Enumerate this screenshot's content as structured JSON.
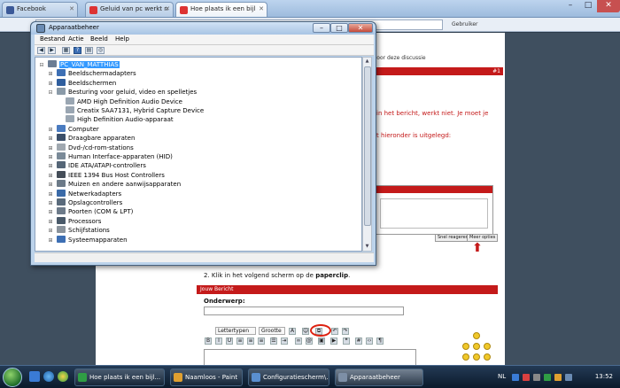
{
  "browser": {
    "tabs": [
      {
        "label": "Facebook"
      },
      {
        "label": "Geluid van pc werkt n"
      },
      {
        "label": "Hoe plaats ik een bijl"
      }
    ],
    "controls": {
      "minimize": "–",
      "maximize": "□",
      "close": "✕"
    },
    "user_label": "Gebruiker"
  },
  "forum": {
    "nav": [
      "doorzoeken",
      "Geef een waardering voor deze discussie"
    ],
    "post_number": "#1",
    "red_lines": [
      "in het bericht, werkt niet. Je moet je",
      "t hieronder is uitgelegd:"
    ],
    "buttons": {
      "preview": "Snel reageren",
      "advanced": "Meer opties"
    },
    "step2_prefix": "2. Klik in het volgend scherm op de",
    "step2_bold": "paperclip",
    "step2_suffix": ".",
    "reply_header": "Jouw Bericht",
    "subject_label": "Onderwerp:",
    "font_select": "Lettertypen",
    "size_select": "Grootte"
  },
  "device_manager": {
    "title": "Apparaatbeheer",
    "menu": [
      "Bestand",
      "Actie",
      "Beeld",
      "Help"
    ],
    "tree": [
      {
        "label": "PC_VAN_MATTHIAS",
        "expander": "⊟",
        "level": 0,
        "icon": "#6b7d94",
        "icon_name": "computer-icon"
      },
      {
        "label": "Beeldschermadapters",
        "expander": "⊞",
        "level": 1,
        "icon": "#3d6fb4",
        "icon_name": "display-adapter-icon"
      },
      {
        "label": "Beeldschermen",
        "expander": "⊞",
        "level": 1,
        "icon": "#2f5e9e",
        "icon_name": "monitor-icon"
      },
      {
        "label": "Besturing voor geluid, video en spelletjes",
        "expander": "⊟",
        "level": 1,
        "icon": "#8a9aa8",
        "icon_name": "sound-icon"
      },
      {
        "label": "AMD High Definition Audio Device",
        "expander": "",
        "level": 2,
        "icon": "#9aa6b2",
        "icon_name": "audio-device-icon"
      },
      {
        "label": "Creatix SAA7131, Hybrid Capture Device",
        "expander": "",
        "level": 2,
        "icon": "#9aa6b2",
        "icon_name": "capture-device-icon"
      },
      {
        "label": "High Definition Audio-apparaat",
        "expander": "",
        "level": 2,
        "icon": "#9aa6b2",
        "icon_name": "audio-device-icon"
      },
      {
        "label": "Computer",
        "expander": "⊞",
        "level": 1,
        "icon": "#4a7bc0",
        "icon_name": "computer-node-icon"
      },
      {
        "label": "Draagbare apparaten",
        "expander": "⊞",
        "level": 1,
        "icon": "#3b4f6a",
        "icon_name": "portable-device-icon"
      },
      {
        "label": "Dvd-/cd-rom-stations",
        "expander": "⊞",
        "level": 1,
        "icon": "#a0a8b0",
        "icon_name": "dvd-drive-icon"
      },
      {
        "label": "Human Interface-apparaten (HID)",
        "expander": "⊞",
        "level": 1,
        "icon": "#7a8a98",
        "icon_name": "hid-icon"
      },
      {
        "label": "IDE ATA/ATAPI-controllers",
        "expander": "⊞",
        "level": 1,
        "icon": "#556677",
        "icon_name": "ide-controller-icon"
      },
      {
        "label": "IEEE 1394 Bus Host Controllers",
        "expander": "⊞",
        "level": 1,
        "icon": "#444d58",
        "icon_name": "firewire-icon"
      },
      {
        "label": "Muizen en andere aanwijsapparaten",
        "expander": "⊞",
        "level": 1,
        "icon": "#6c7a88",
        "icon_name": "mouse-icon"
      },
      {
        "label": "Netwerkadapters",
        "expander": "⊞",
        "level": 1,
        "icon": "#3a6aa8",
        "icon_name": "network-adapter-icon"
      },
      {
        "label": "Opslagcontrollers",
        "expander": "⊞",
        "level": 1,
        "icon": "#5a6b7c",
        "icon_name": "storage-controller-icon"
      },
      {
        "label": "Poorten (COM & LPT)",
        "expander": "⊞",
        "level": 1,
        "icon": "#6d7b8a",
        "icon_name": "port-icon"
      },
      {
        "label": "Processors",
        "expander": "⊞",
        "level": 1,
        "icon": "#4a5a6a",
        "icon_name": "processor-icon"
      },
      {
        "label": "Schijfstations",
        "expander": "⊞",
        "level": 1,
        "icon": "#8a939c",
        "icon_name": "disk-drive-icon"
      },
      {
        "label": "Systeemapparaten",
        "expander": "⊞",
        "level": 1,
        "icon": "#3d6fb4",
        "icon_name": "system-device-icon"
      }
    ]
  },
  "taskbar": {
    "tasks": [
      {
        "label": "Hoe plaats ik een bijl...",
        "icon": "#2f9e44",
        "active": false
      },
      {
        "label": "Naamloos - Paint",
        "icon": "#e0a030",
        "active": false
      },
      {
        "label": "Configuratiescherm\\...",
        "icon": "#5a8fd0",
        "active": false
      },
      {
        "label": "Apparaatbeheer",
        "icon": "#7d8fa6",
        "active": true
      }
    ],
    "language": "NL",
    "clock": "13:52"
  },
  "colors": {
    "forum_red": "#c41a1a",
    "selection_blue": "#3399ff",
    "window_frame": "#bcd3eb"
  }
}
